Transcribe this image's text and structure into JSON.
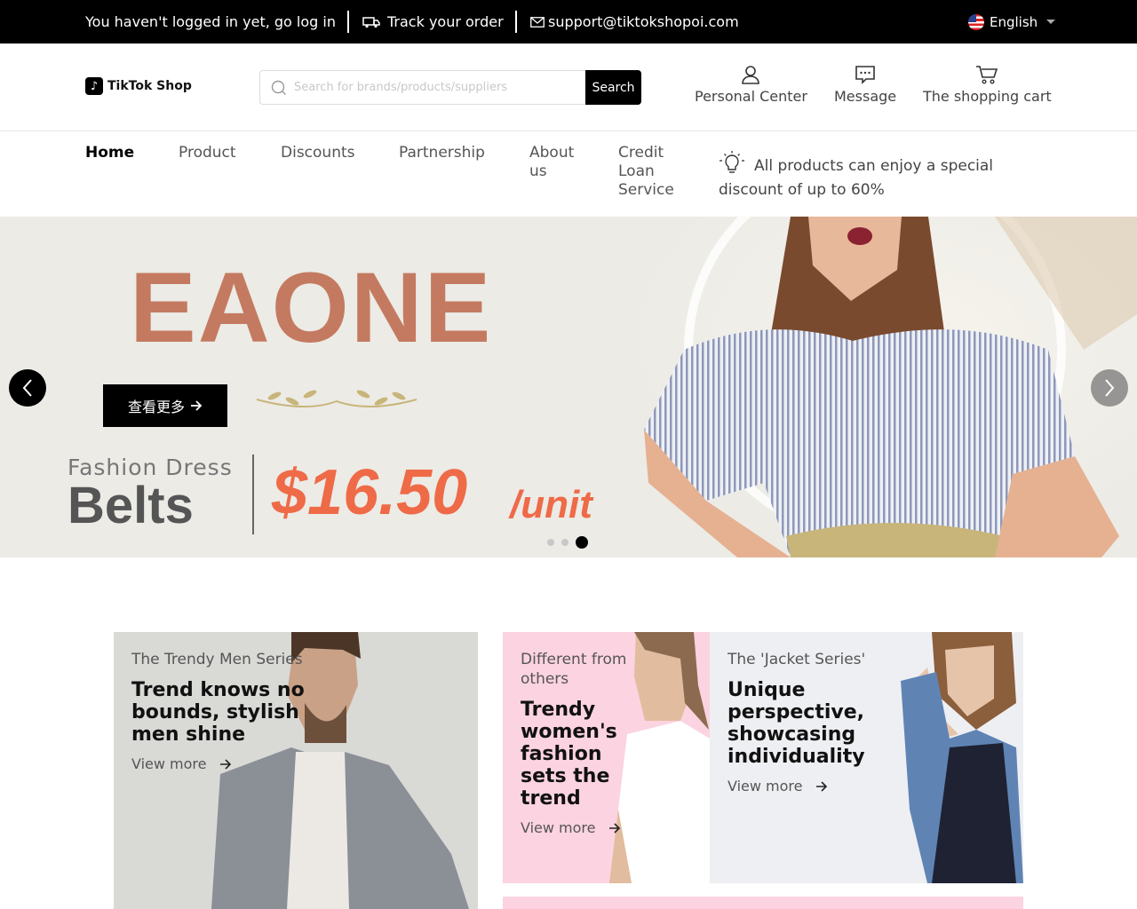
{
  "topbar": {
    "login_text": "You haven't logged in yet, go log in",
    "track_text": "Track your order",
    "email_text": "support@tiktokshopoi.com",
    "language": "English"
  },
  "header": {
    "logo_text": "TikTok Shop",
    "search_placeholder": "Search for brands/products/suppliers",
    "search_button": "Search",
    "actions": [
      {
        "label": "Personal Center",
        "icon": "user-icon"
      },
      {
        "label": "Message",
        "icon": "message-icon"
      },
      {
        "label": "The shopping cart",
        "icon": "cart-icon"
      }
    ]
  },
  "nav": {
    "items": [
      {
        "label": "Home",
        "active": true
      },
      {
        "label": "Product"
      },
      {
        "label": "Discounts"
      },
      {
        "label": "Partnership"
      },
      {
        "label": "About us"
      },
      {
        "label": "Credit Loan Service"
      }
    ],
    "promo": "All products can enjoy a special discount of up to 60%"
  },
  "hero": {
    "brand": "EAONE",
    "cta": "查看更多",
    "subtitle": "Fashion Dress",
    "product": "Belts",
    "price": "$16.50",
    "unit": "/unit",
    "slide_count": 3,
    "active_slide": 3
  },
  "categories": [
    {
      "eyebrow": "The Trendy Men Series",
      "headline": "Trend knows no bounds, stylish men shine",
      "more": "View more"
    },
    {
      "eyebrow": "Different from others",
      "headline": "Trendy women's fashion sets the trend",
      "more": "View more"
    },
    {
      "eyebrow": "The 'Jacket Series'",
      "headline": "Unique perspective, showcasing individuality",
      "more": "View more"
    }
  ],
  "colors": {
    "brand_accent": "#ef6a47",
    "hero_title": "#c47a60",
    "pink_card": "#fcd3e0",
    "grey_card": "#eeeff3"
  }
}
